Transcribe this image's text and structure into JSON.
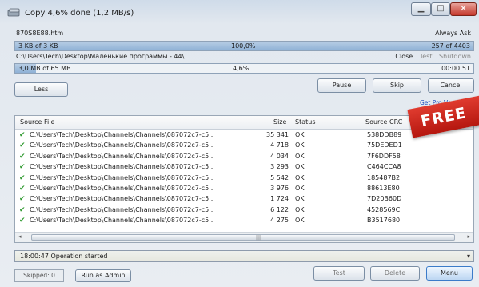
{
  "window": {
    "title": "Copy 4,6% done (1,2 MB/s)",
    "minimize_icon": "minimize-icon",
    "maximize_icon": "maximize-icon",
    "close_icon": "close-icon"
  },
  "current_file": {
    "name": "870S8E88.htm",
    "overwrite_mode": "Always Ask",
    "progress_text": "3 KB of 3 KB",
    "progress_percent": "100,0%",
    "progress_fraction": 1.0,
    "count": "257 of 4403"
  },
  "destination": {
    "path": "C:\\Users\\Tech\\Desktop\\Маленькие программы - 44\\",
    "close_label": "Close",
    "test_label": "Test",
    "shutdown_label": "Shutdown",
    "progress_text": "3,0 MB of 65 MB",
    "progress_percent": "4,6%",
    "progress_fraction": 0.046,
    "elapsed": "00:00:51"
  },
  "buttons": {
    "less": "Less",
    "pause": "Pause",
    "skip": "Skip",
    "cancel": "Cancel",
    "pro_link": "Get Pro Version"
  },
  "badge": "FREE",
  "table": {
    "headers": {
      "file": "Source File",
      "size": "Size",
      "status": "Status",
      "crc": "Source CRC"
    },
    "rows": [
      {
        "file": "C:\\Users\\Tech\\Desktop\\Channels\\Channels\\087072c7-c5...",
        "size": "35 341",
        "status": "OK",
        "crc": "538DDB89"
      },
      {
        "file": "C:\\Users\\Tech\\Desktop\\Channels\\Channels\\087072c7-c5...",
        "size": "4 718",
        "status": "OK",
        "crc": "75DEDED1"
      },
      {
        "file": "C:\\Users\\Tech\\Desktop\\Channels\\Channels\\087072c7-c5...",
        "size": "4 034",
        "status": "OK",
        "crc": "7F6DDF58"
      },
      {
        "file": "C:\\Users\\Tech\\Desktop\\Channels\\Channels\\087072c7-c5...",
        "size": "3 293",
        "status": "OK",
        "crc": "C464CCA8"
      },
      {
        "file": "C:\\Users\\Tech\\Desktop\\Channels\\Channels\\087072c7-c5...",
        "size": "5 542",
        "status": "OK",
        "crc": "185487B2"
      },
      {
        "file": "C:\\Users\\Tech\\Desktop\\Channels\\Channels\\087072c7-c5...",
        "size": "3 976",
        "status": "OK",
        "crc": "88613E80"
      },
      {
        "file": "C:\\Users\\Tech\\Desktop\\Channels\\Channels\\087072c7-c5...",
        "size": "1 724",
        "status": "OK",
        "crc": "7D20B60D"
      },
      {
        "file": "C:\\Users\\Tech\\Desktop\\Channels\\Channels\\087072c7-c5...",
        "size": "6 122",
        "status": "OK",
        "crc": "4528569C"
      },
      {
        "file": "C:\\Users\\Tech\\Desktop\\Channels\\Channels\\087072c7-c5...",
        "size": "4 275",
        "status": "OK",
        "crc": "B3517680"
      }
    ]
  },
  "log": {
    "text": "18:00:47 Operation started"
  },
  "footer": {
    "skipped": "Skipped: 0",
    "run_as_admin": "Run as Admin",
    "test": "Test",
    "delete": "Delete",
    "menu": "Menu"
  }
}
